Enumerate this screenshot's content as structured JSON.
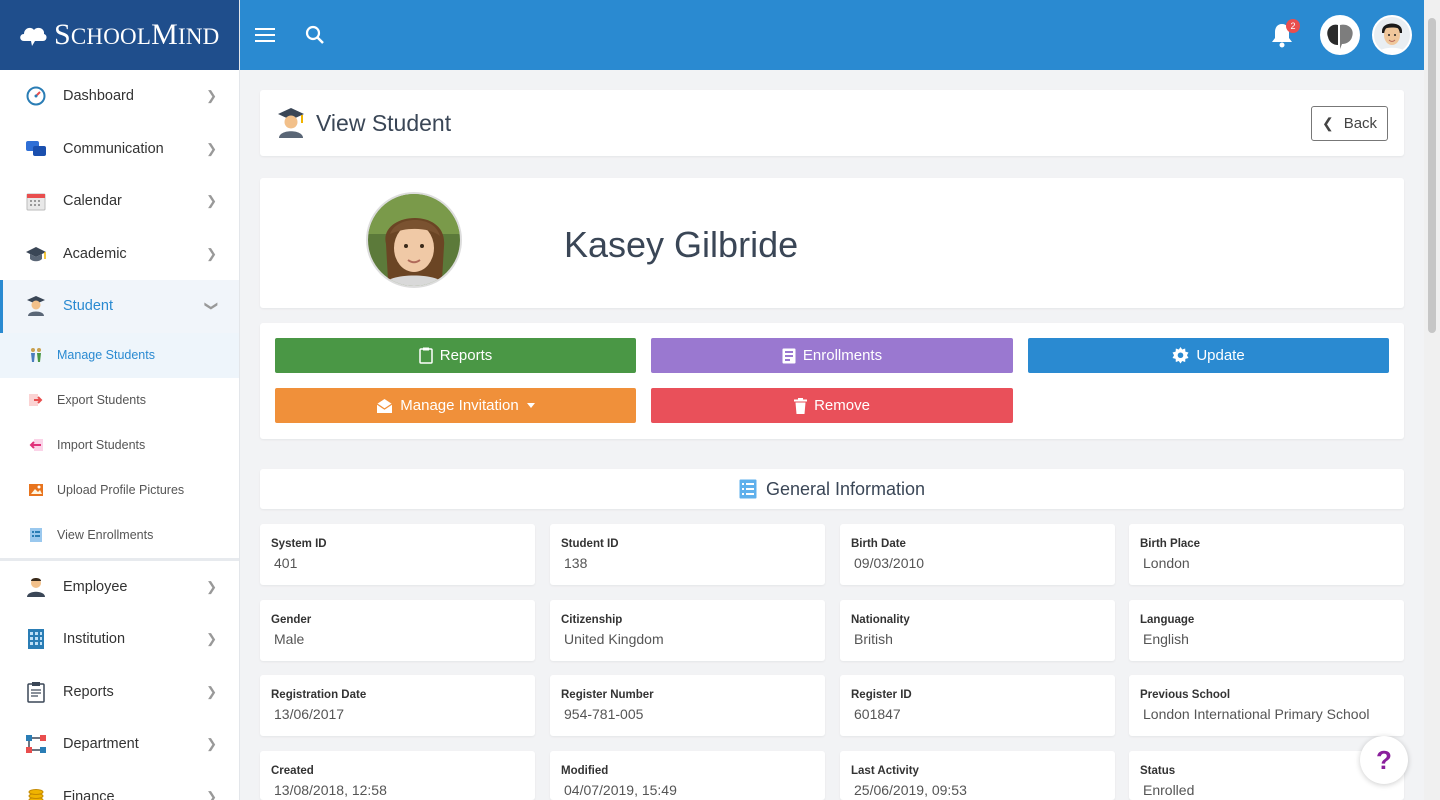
{
  "brand": {
    "name_first": "S",
    "name_rest1": "CHOOL",
    "name_mid": "M",
    "name_rest2": "IND"
  },
  "sidebar": {
    "items": [
      {
        "label": "Dashboard",
        "icon": "dashboard-gauge-icon"
      },
      {
        "label": "Communication",
        "icon": "chat-bubbles-icon"
      },
      {
        "label": "Calendar",
        "icon": "calendar-icon"
      },
      {
        "label": "Academic",
        "icon": "graduation-cap-icon"
      },
      {
        "label": "Student",
        "icon": "student-icon"
      },
      {
        "label": "Employee",
        "icon": "employee-icon"
      },
      {
        "label": "Institution",
        "icon": "building-icon"
      },
      {
        "label": "Reports",
        "icon": "clipboard-icon"
      },
      {
        "label": "Department",
        "icon": "org-chart-icon"
      },
      {
        "label": "Finance",
        "icon": "coins-icon"
      }
    ],
    "student_sub": [
      {
        "label": "Manage Students"
      },
      {
        "label": "Export Students"
      },
      {
        "label": "Import Students"
      },
      {
        "label": "Upload Profile Pictures"
      },
      {
        "label": "View Enrollments"
      }
    ]
  },
  "topbar": {
    "notification_count": "2"
  },
  "page": {
    "title": "View Student",
    "back_label": "Back"
  },
  "student": {
    "name": "Kasey Gilbride"
  },
  "actions": {
    "reports": "Reports",
    "enrollments": "Enrollments",
    "update": "Update",
    "manage_invitation": "Manage Invitation",
    "remove": "Remove"
  },
  "section": {
    "title": "General Information"
  },
  "info": [
    {
      "label": "System ID",
      "value": "401"
    },
    {
      "label": "Student ID",
      "value": "138"
    },
    {
      "label": "Birth Date",
      "value": "09/03/2010"
    },
    {
      "label": "Birth Place",
      "value": "London"
    },
    {
      "label": "Gender",
      "value": "Male"
    },
    {
      "label": "Citizenship",
      "value": "United Kingdom"
    },
    {
      "label": "Nationality",
      "value": "British"
    },
    {
      "label": "Language",
      "value": "English"
    },
    {
      "label": "Registration Date",
      "value": "13/06/2017"
    },
    {
      "label": "Register Number",
      "value": "954-781-005"
    },
    {
      "label": "Register ID",
      "value": "601847"
    },
    {
      "label": "Previous School",
      "value": "London International Primary School"
    },
    {
      "label": "Created",
      "value": "13/08/2018, 12:58"
    },
    {
      "label": "Modified",
      "value": "04/07/2019, 15:49"
    },
    {
      "label": "Last Activity",
      "value": "25/06/2019, 09:53"
    },
    {
      "label": "Status",
      "value": "Enrolled"
    }
  ],
  "help": {
    "label": "?"
  },
  "colors": {
    "brand": "#1f4e8c",
    "topbar": "#2a8ad1",
    "green": "#4a9745",
    "purple": "#9a78d0",
    "orange": "#f0903a",
    "red": "#e9505a"
  }
}
